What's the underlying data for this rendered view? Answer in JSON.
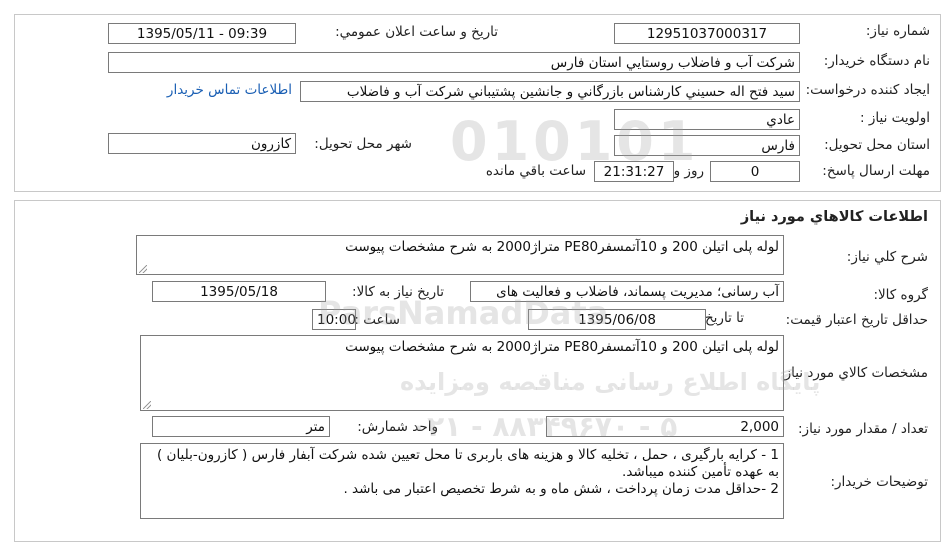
{
  "header": {
    "need_number_label": "شماره نياز:",
    "need_number": "12951037000317",
    "announce_label": "تاريخ و ساعت اعلان عمومي:",
    "announce_value": "1395/05/11 - 09:39",
    "buyer_org_label": "نام دستگاه خريدار:",
    "buyer_org": "شرکت آب و فاضلاب روستايي استان فارس",
    "requester_label": "ايجاد کننده درخواست:",
    "requester": "سيد فتح اله حسيني کارشناس بازرگاني و جانشين پشتيباني شرکت آب و فاضلاب",
    "contact_link": "اطلاعات تماس خريدار",
    "priority_label": "اولويت نياز :",
    "priority": "عادي",
    "province_label": "استان محل تحويل:",
    "province": "فارس",
    "city_label": "شهر محل تحويل:",
    "city": "کازرون",
    "deadline_label": "مهلت ارسال پاسخ:",
    "days": "0",
    "days_label": "روز و",
    "time_left": "21:31:27",
    "time_left_label": "ساعت باقي مانده"
  },
  "goods": {
    "section_title": "اطلاعات کالاهاي مورد نياز",
    "general_desc_label": "شرح کلي نياز:",
    "general_desc": "لوله پلی اتیلن 200 و 10آتمسفرPE80 متراژ2000 به شرح مشخصات پیوست",
    "group_label": "گروه کالا:",
    "group": "آب رسانی؛ مدیریت پسماند، فاضلاب و فعالیت های",
    "need_date_label": "تاريخ نياز به کالا:",
    "need_date": "1395/05/18",
    "validity_label": "حداقل تاريخ اعتبار قيمت:",
    "until_label": "تا تاريخ :",
    "until_date": "1395/06/08",
    "hour_label": "ساعت :",
    "hour": "10:00",
    "spec_label": "مشخصات کالاي مورد نياز:",
    "spec": "لوله پلی اتیلن 200 و 10آتمسفرPE80 متراژ2000 به شرح مشخصات پیوست",
    "qty_label": "تعداد / مقدار مورد نياز:",
    "qty": "2,000",
    "unit_label": "واحد شمارش:",
    "unit": "متر",
    "notes_label": "توضيحات خريدار:",
    "notes_line1": "1 - کرایه بارگیری ، حمل ، تخلیه کالا و هزینه های باربری تا محل تعیین شده شرکت آبفار فارس ( کازرون-بلیان ) به عهده تأمین کننده میباشد.",
    "notes_line2": "2 -حداقل مدت زمان پرداخت ، شش ماه و به شرط تخصیص اعتبار می باشد ."
  },
  "watermark": {
    "digits": "010101",
    "latin": "ParsNamadData",
    "fa_title": "پایگاه اطلاع رسانی مناقصه ومزایده",
    "phone": "۰۲۱ - ۸۸۳۴۹۶۷۰ - ۵"
  }
}
